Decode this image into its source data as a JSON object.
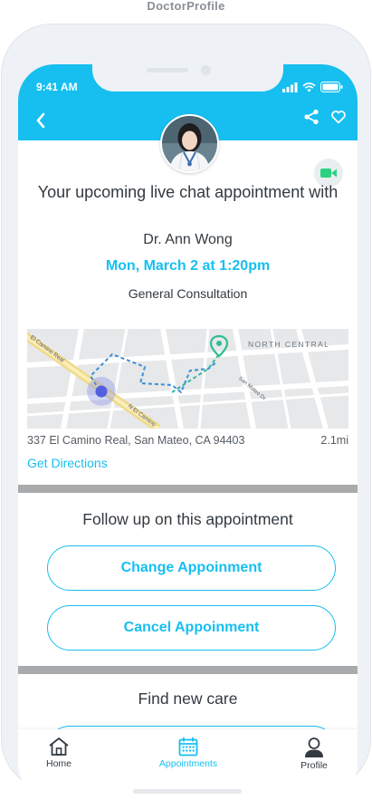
{
  "screen_title": "DoctorProfile",
  "status": {
    "time": "9:41 AM"
  },
  "header": {
    "icons": [
      "chevron-left-icon",
      "share-icon",
      "heart-icon"
    ],
    "background_color": "#16bff0"
  },
  "appointment": {
    "heading": "Your upcoming live chat appointment with",
    "doctor": "Dr. Ann Wong",
    "datetime": "Mon, March 2 at 1:20pm",
    "type": "General Consultation"
  },
  "map": {
    "labels": [
      "El Camino Real",
      "N El Camino",
      "NORTH CENTRAL",
      "San Mateo Dr"
    ],
    "address": "337 El Camino Real, San Mateo, CA 94403",
    "distance": "2.1mi",
    "directions_label": "Get Directions"
  },
  "follow_up": {
    "title": "Follow up on this appointment",
    "change_label": "Change Appoinment",
    "cancel_label": "Cancel Appoinment"
  },
  "find_care": {
    "title": "Find new care"
  },
  "tabs": [
    {
      "label": "Home",
      "icon": "home-icon",
      "active": false
    },
    {
      "label": "Appointments",
      "icon": "calendar-icon",
      "active": true
    },
    {
      "label": "Profile",
      "icon": "user-icon",
      "active": false
    }
  ],
  "colors": {
    "accent": "#16bff0",
    "divider": "#a8aaab",
    "video": "#2cd27f"
  }
}
